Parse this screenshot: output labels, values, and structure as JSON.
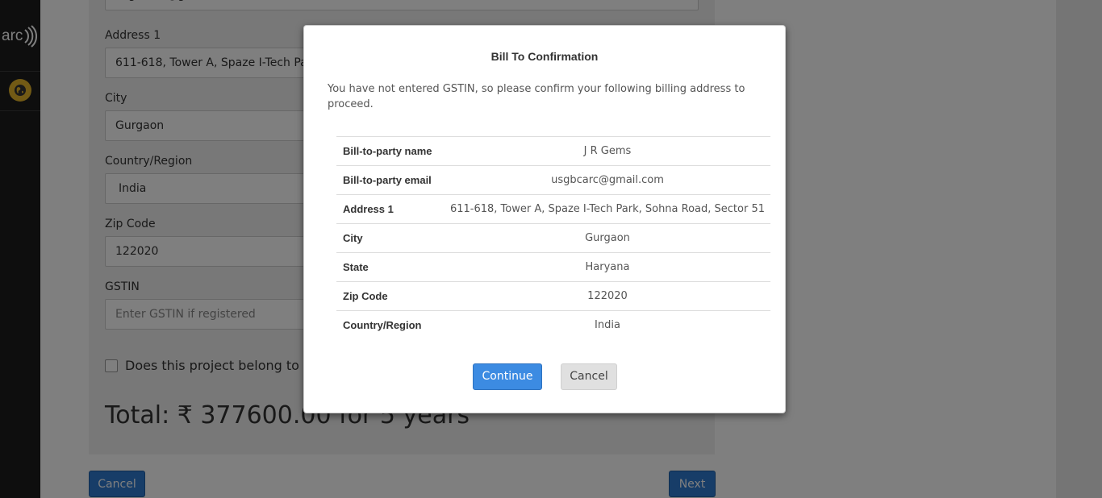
{
  "sidebar": {
    "logo_text": "arc",
    "logo_icon": "signal-waves-icon",
    "globe_icon": "globe-icon",
    "globe_color": "#e5b52b"
  },
  "form": {
    "email_value": "usgbcarc@gmail.com",
    "address1_label": "Address 1",
    "address1_value": "611-618, Tower A, Spaze I-Tech Park, Sohna Road, Sector 51",
    "city_label": "City",
    "city_value": "Gurgaon",
    "country_label": "Country/Region",
    "country_value": "India",
    "zip_label": "Zip Code",
    "zip_value": "122020",
    "gstin_label": "GSTIN",
    "gstin_placeholder": "Enter GSTIN if registered",
    "checkbox_label": "Does this project belong to Sp",
    "total_text": "Total: ₹ 377600.00 for 5 years",
    "cancel_label": "Cancel",
    "next_label": "Next",
    "primary_color": "#2e7ad1"
  },
  "modal": {
    "title": "Bill To Confirmation",
    "description": "You have not entered GSTIN, so please confirm your following billing address to proceed.",
    "rows": [
      {
        "label": "Bill-to-party name",
        "value": "J R Gems"
      },
      {
        "label": "Bill-to-party email",
        "value": "usgbcarc@gmail.com"
      },
      {
        "label": "Address 1",
        "value": "611-618, Tower A, Spaze I-Tech Park, Sohna Road, Sector 51"
      },
      {
        "label": "City",
        "value": "Gurgaon"
      },
      {
        "label": "State",
        "value": "Haryana"
      },
      {
        "label": "Zip Code",
        "value": "122020"
      },
      {
        "label": "Country/Region",
        "value": "India"
      }
    ],
    "continue_label": "Continue",
    "cancel_label": "Cancel",
    "continue_color": "#3c8be2"
  }
}
